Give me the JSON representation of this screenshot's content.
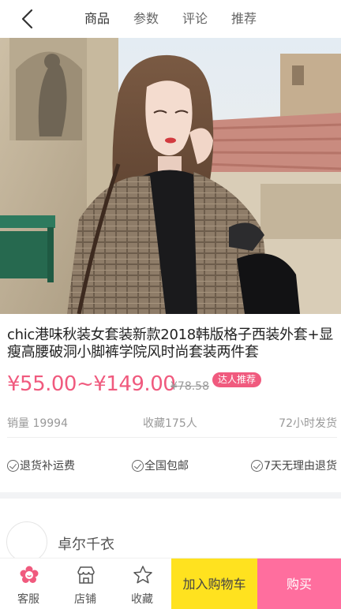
{
  "nav": {
    "tabs": [
      {
        "label": "商品"
      },
      {
        "label": "参数"
      },
      {
        "label": "评论"
      },
      {
        "label": "推荐"
      }
    ]
  },
  "product": {
    "title": "chic港味秋装女套装新款2018韩版格子西装外套+显瘦高腰破洞小脚裤学院风时尚套装两件套",
    "price": "¥55.00~¥149.00",
    "original_price": "¥78.58",
    "badge": "达人推荐",
    "sales": "销量 19994",
    "favorites": "收藏175人",
    "shipping": "72小时发货"
  },
  "services": [
    {
      "label": "退货补运费"
    },
    {
      "label": "全国包邮"
    },
    {
      "label": "7天无理由退货"
    }
  ],
  "shop": {
    "name": "卓尔千衣"
  },
  "bottom": {
    "service_label": "客服",
    "store_label": "店铺",
    "favorite_label": "收藏",
    "cart_label": "加入购物车",
    "buy_label": "购买"
  },
  "colors": {
    "price": "#f05a7e",
    "cart_button": "#ffe21f",
    "buy_button": "#ff6e9e"
  }
}
